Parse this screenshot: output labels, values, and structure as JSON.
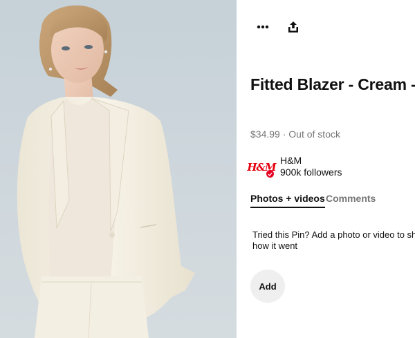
{
  "pin": {
    "image_alt": "Model wearing a cream fitted blazer",
    "title": "Fitted Blazer - Cream - US",
    "price": "$34.99",
    "price_separator": " · ",
    "stock_status": "Out of stock"
  },
  "toolbar": {
    "more_icon": "more-horizontal-icon",
    "share_icon": "share-upload-icon"
  },
  "brand": {
    "logo_text": "H&M",
    "name": "H&M",
    "followers": "900k followers",
    "logo_color": "#e50010",
    "verified_color": "#e60023"
  },
  "tabs": [
    {
      "label": "Photos + videos",
      "active": true
    },
    {
      "label": "Comments",
      "active": false
    }
  ],
  "tried_prompt": "Tried this Pin? Add a photo or video to share how it went",
  "add_button_label": "Add"
}
